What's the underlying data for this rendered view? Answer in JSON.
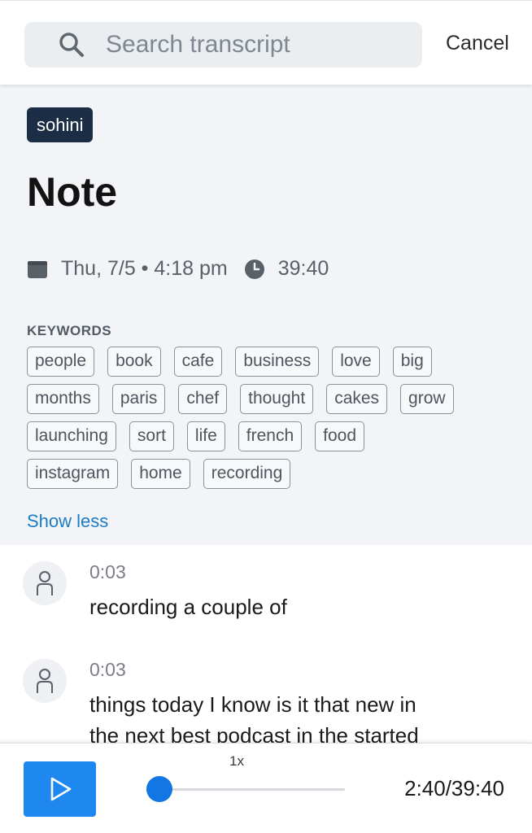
{
  "search": {
    "placeholder": "Search transcript",
    "cancel_label": "Cancel"
  },
  "note": {
    "speaker_tag": "sohini",
    "title": "Note",
    "date": "Thu, 7/5 • 4:18 pm",
    "duration": "39:40",
    "keywords_label": "KEYWORDS",
    "keywords": [
      [
        "people",
        "book",
        "cafe",
        "business",
        "love",
        "big"
      ],
      [
        "months",
        "paris",
        "chef",
        "thought",
        "cakes",
        "grow"
      ],
      [
        "launching",
        "sort",
        "life",
        "french",
        "food"
      ],
      [
        "instagram",
        "home",
        "recording"
      ]
    ],
    "show_less_label": "Show less"
  },
  "transcript": [
    {
      "timestamp": "0:03",
      "lines": [
        "recording a couple of"
      ]
    },
    {
      "timestamp": "0:03",
      "lines": [
        "things today I know is it that new in",
        "the next best podcast in the started"
      ]
    }
  ],
  "player": {
    "speed": "1x",
    "current_time": "2:40",
    "total_time": "39:40",
    "time_display": "2:40/39:40",
    "progress_fraction": 0.0674,
    "accent_color": "#1e88f0"
  },
  "icons": {
    "search": "search-icon",
    "calendar": "calendar-icon",
    "clock": "clock-icon",
    "person": "person-icon",
    "play": "play-icon"
  }
}
